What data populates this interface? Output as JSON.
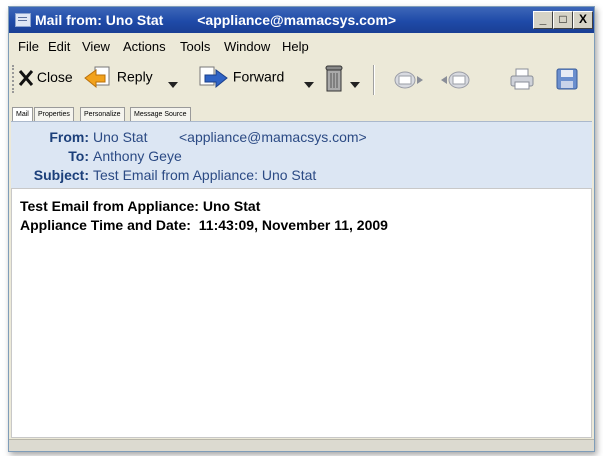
{
  "window": {
    "title_prefix": "Mail from:",
    "title_name": "Uno Stat",
    "title_address": "<appliance@mamacsys.com>",
    "minimize": "_",
    "maximize": "□",
    "close": "X"
  },
  "menu": [
    "File",
    "Edit",
    "View",
    "Actions",
    "Tools",
    "Window",
    "Help"
  ],
  "toolbar": {
    "close_label": "Close",
    "reply_label": "Reply",
    "forward_label": "Forward"
  },
  "tabs": [
    "Mail",
    "Properties",
    "Personalize",
    "Message Source"
  ],
  "header": {
    "from_label": "From:",
    "from_name": "Uno Stat",
    "from_address": "<appliance@mamacsys.com>",
    "to_label": "To:",
    "to_value": "Anthony Geye",
    "subject_label": "Subject:",
    "subject_value": "Test Email from Appliance: Uno Stat"
  },
  "body": {
    "line1_label": "Test Email from Appliance:",
    "line1_value": "Uno Stat",
    "line2_label": "Appliance Time and Date:",
    "line2_value": "11:43:09, November 11, 2009"
  }
}
